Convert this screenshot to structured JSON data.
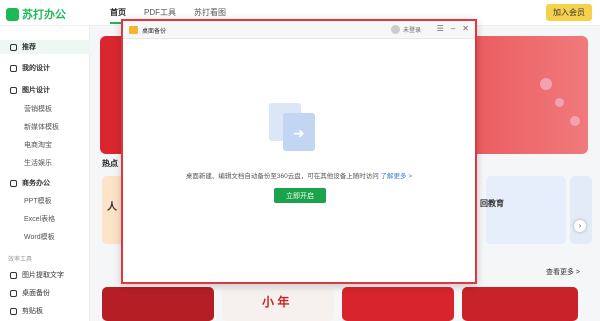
{
  "app": {
    "logo_text": "苏打办公"
  },
  "nav": {
    "items": [
      "首页",
      "PDF工具",
      "苏打看图"
    ]
  },
  "header": {
    "join_label": "加入会员"
  },
  "sidebar": {
    "items": [
      {
        "label": "推荐"
      },
      {
        "label": "我的设计"
      },
      {
        "label": "图片设计"
      },
      {
        "label": "营销模板"
      },
      {
        "label": "新媒体模板"
      },
      {
        "label": "电商淘宝"
      },
      {
        "label": "生活娱乐"
      },
      {
        "label": "商务办公"
      },
      {
        "label": "PPT模板"
      },
      {
        "label": "Excel表格"
      },
      {
        "label": "Word模板"
      }
    ],
    "tools_section": "效率工具",
    "tools": [
      {
        "label": "图片提取文字"
      },
      {
        "label": "桌面备份"
      },
      {
        "label": "剪贴板"
      }
    ]
  },
  "main": {
    "hot_title": "热点",
    "more_label": "查看更多 >",
    "card_texts": [
      "人",
      "回教育",
      "小 年"
    ]
  },
  "dialog": {
    "title": "桌面备份",
    "login_label": "未登录",
    "description": "桌面新建、编辑文档自动备份至360云盘，可在其他设备上随时访问",
    "learn_more": "了解更多 >",
    "start_label": "立即开启"
  },
  "colors": {
    "brand": "#1db954",
    "accent": "#d9393f",
    "button": "#1aa34a"
  }
}
